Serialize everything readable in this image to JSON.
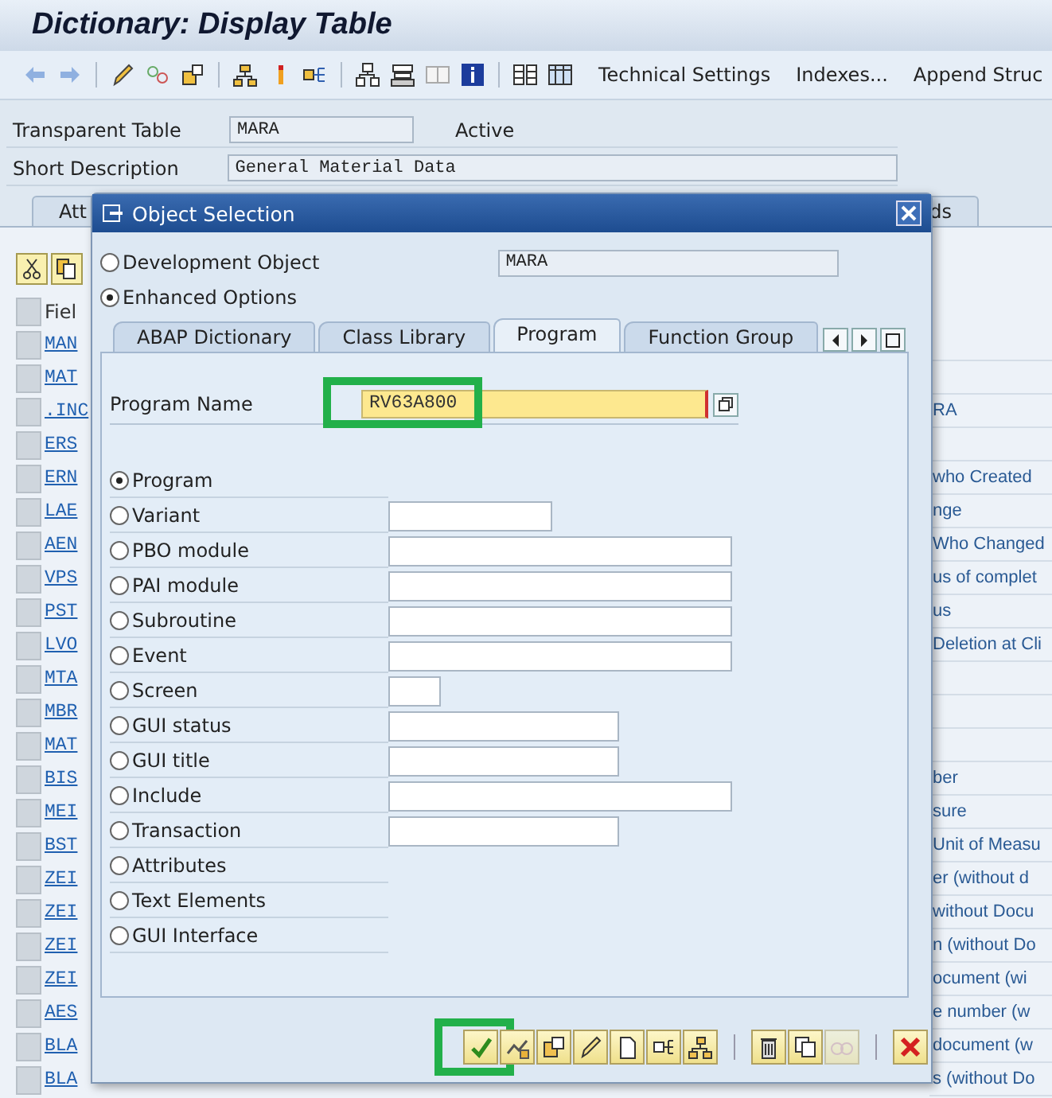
{
  "window": {
    "title": "Dictionary: Display Table"
  },
  "toolbar": {
    "buttons": [
      "Technical Settings",
      "Indexes...",
      "Append Struc"
    ]
  },
  "header_fields": [
    {
      "label": "Transparent Table",
      "value": "MARA",
      "status": "Active",
      "kind": "short"
    },
    {
      "label": "Short Description",
      "value": "General Material Data",
      "kind": "long"
    }
  ],
  "background_tabs": [
    "Att",
    "ds"
  ],
  "fields_table": {
    "column_1": "Fiel",
    "rows": [
      {
        "field": "MAN"
      },
      {
        "field": "MAT"
      },
      {
        "field": ".INC",
        "description": "RA"
      },
      {
        "field": "ERS"
      },
      {
        "field": "ERN",
        "description": "who Created"
      },
      {
        "field": "LAE",
        "description": "nge"
      },
      {
        "field": "AEN",
        "description": "Who Changed"
      },
      {
        "field": "VPS",
        "description": "us of complet"
      },
      {
        "field": "PST",
        "description": "us"
      },
      {
        "field": "LVO",
        "description": "Deletion at Cli"
      },
      {
        "field": "MTA"
      },
      {
        "field": "MBR"
      },
      {
        "field": "MAT"
      },
      {
        "field": "BIS",
        "description": "ber"
      },
      {
        "field": "MEI",
        "description": "sure"
      },
      {
        "field": "BST",
        "description": "Unit of Measu"
      },
      {
        "field": "ZEI",
        "description": "er (without d"
      },
      {
        "field": "ZEI",
        "description": "without Docu"
      },
      {
        "field": "ZEI",
        "description": "n (without Do"
      },
      {
        "field": "ZEI",
        "description": "ocument (wi"
      },
      {
        "field": "AES",
        "description": "e number (w"
      },
      {
        "field": "BLA",
        "description": "document (w"
      },
      {
        "field": "BLA",
        "description": "s (without Do"
      }
    ]
  },
  "dialog": {
    "title": "Object Selection",
    "scope_options": [
      {
        "label": "Development Object",
        "selected": false,
        "value": "MARA"
      },
      {
        "label": "Enhanced Options",
        "selected": true
      }
    ],
    "tabs": [
      {
        "label": "ABAP Dictionary",
        "selected": false
      },
      {
        "label": "Class Library",
        "selected": false
      },
      {
        "label": "Program",
        "selected": true
      },
      {
        "label": "Function Group",
        "selected": false
      }
    ],
    "program_name": {
      "label": "Program Name",
      "value": "RV63A800",
      "highlighted": true
    },
    "object_types": [
      {
        "label": "Program",
        "selected": true,
        "kind": "none"
      },
      {
        "label": "Variant",
        "selected": false,
        "kind": "short"
      },
      {
        "label": "PBO module",
        "selected": false,
        "kind": "long"
      },
      {
        "label": "PAI module",
        "selected": false,
        "kind": "long"
      },
      {
        "label": "Subroutine",
        "selected": false,
        "kind": "long"
      },
      {
        "label": "Event",
        "selected": false,
        "kind": "long"
      },
      {
        "label": "Screen",
        "selected": false,
        "kind": "tiny"
      },
      {
        "label": "GUI status",
        "selected": false,
        "kind": "medium"
      },
      {
        "label": "GUI title",
        "selected": false,
        "kind": "medium"
      },
      {
        "label": "Include",
        "selected": false,
        "kind": "long"
      },
      {
        "label": "Transaction",
        "selected": false,
        "kind": "medium"
      },
      {
        "label": "Attributes",
        "selected": false,
        "kind": "none"
      },
      {
        "label": "Text Elements",
        "selected": false,
        "kind": "none"
      },
      {
        "label": "GUI Interface",
        "selected": false,
        "kind": "none"
      }
    ],
    "buttons": [
      {
        "kind": "confirm",
        "highlighted": true,
        "disabled": false
      },
      {
        "kind": "where_used",
        "highlighted": false,
        "disabled": false
      },
      {
        "kind": "copy",
        "highlighted": false,
        "disabled": false
      },
      {
        "kind": "edit",
        "highlighted": false,
        "disabled": false
      },
      {
        "kind": "new",
        "highlighted": false,
        "disabled": false
      },
      {
        "kind": "share",
        "highlighted": false,
        "disabled": false
      },
      {
        "kind": "hierarchy",
        "highlighted": false,
        "disabled": false
      },
      {
        "kind": "separator"
      },
      {
        "kind": "delete",
        "highlighted": false,
        "disabled": false
      },
      {
        "kind": "duplicate",
        "highlighted": false,
        "disabled": false
      },
      {
        "kind": "display",
        "highlighted": false,
        "disabled": true
      },
      {
        "kind": "separator"
      },
      {
        "kind": "cancel",
        "highlighted": false,
        "disabled": false
      }
    ]
  }
}
